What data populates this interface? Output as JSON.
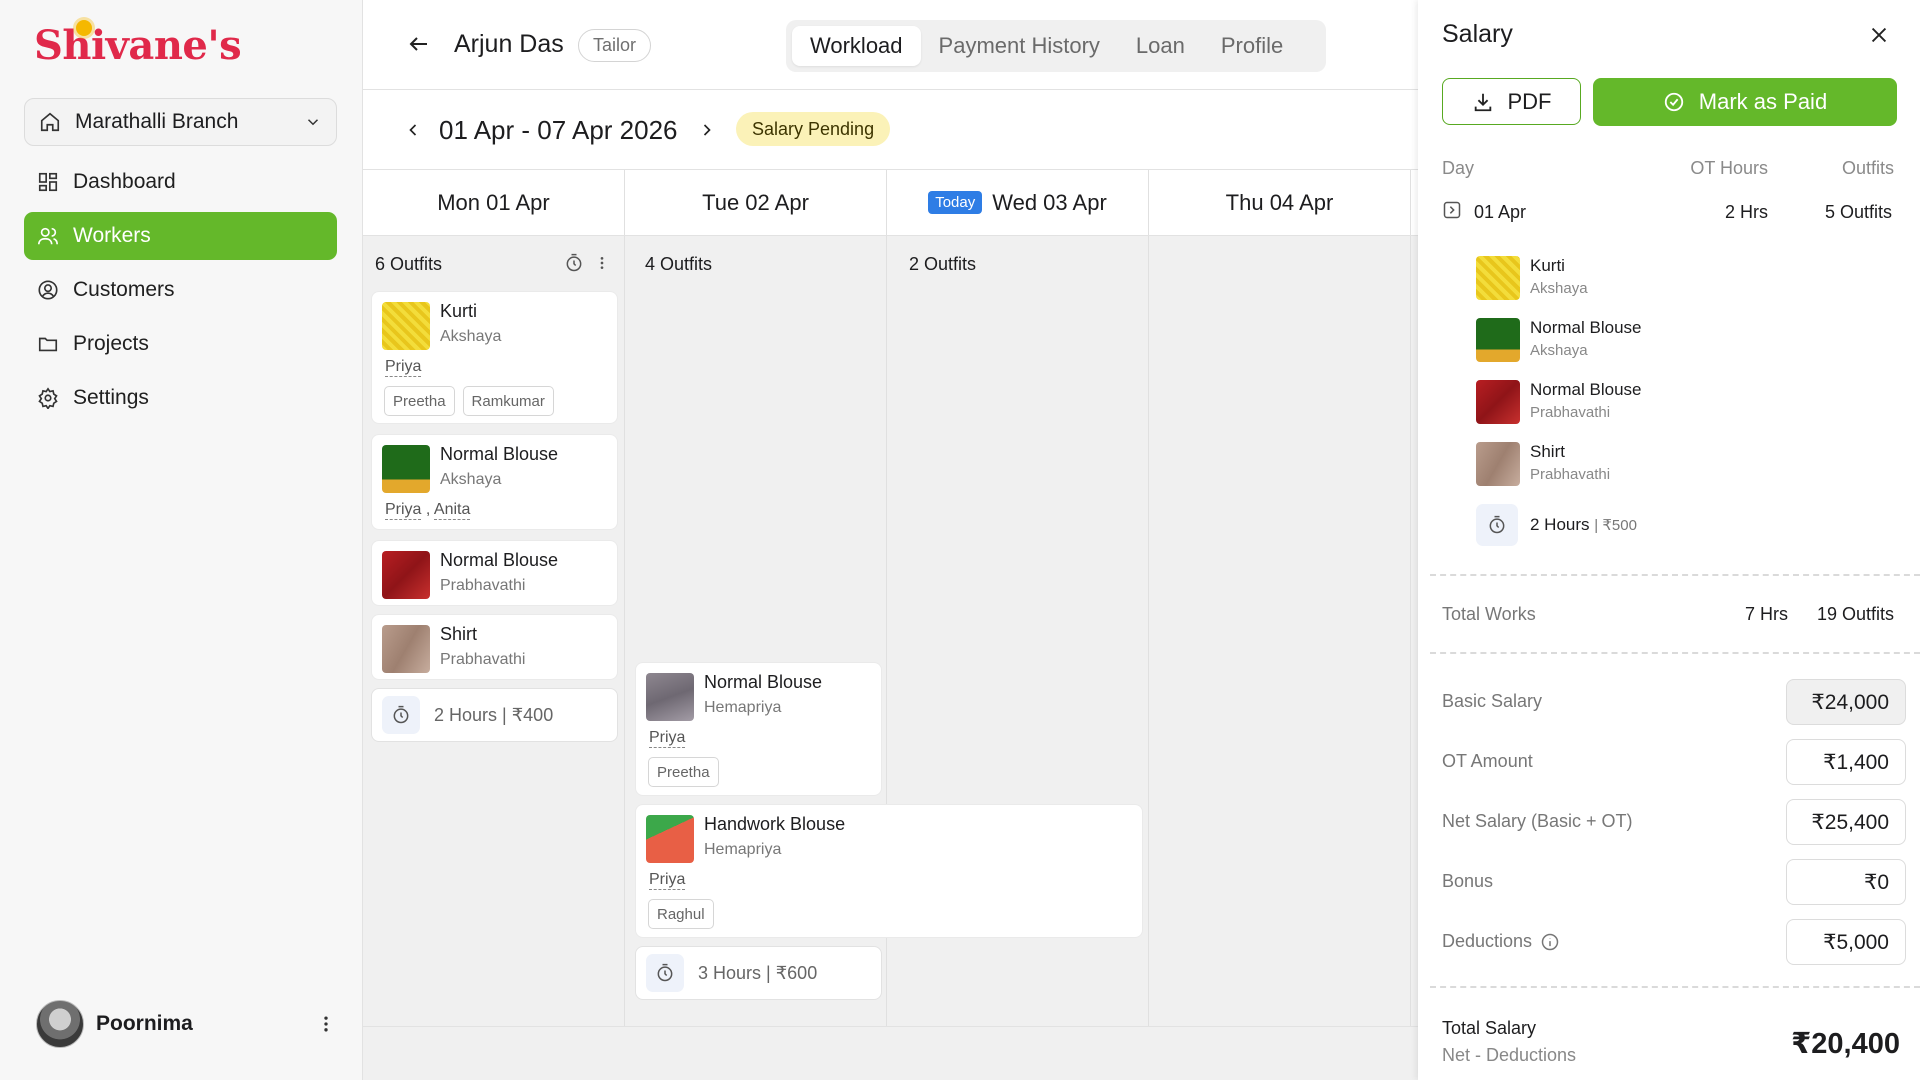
{
  "brand": {
    "name": "Shivane's",
    "colors": {
      "primary": "#64b82a",
      "brand_red": "#e0294a",
      "today": "#2e7de5",
      "pending_bg": "#fbf2b8"
    }
  },
  "sidebar": {
    "branch": "Marathalli Branch",
    "items": [
      {
        "label": "Dashboard",
        "icon": "grid-icon"
      },
      {
        "label": "Workers",
        "icon": "users-icon",
        "active": true
      },
      {
        "label": "Customers",
        "icon": "user-circle-icon"
      },
      {
        "label": "Projects",
        "icon": "folder-icon"
      },
      {
        "label": "Settings",
        "icon": "gear-icon"
      }
    ],
    "user": {
      "name": "Poornima"
    }
  },
  "header": {
    "worker_name": "Arjun Das",
    "role": "Tailor",
    "tabs": [
      "Workload",
      "Payment History",
      "Loan",
      "Profile"
    ],
    "active_tab": "Workload"
  },
  "week": {
    "range": "01 Apr - 07 Apr 2026",
    "status": "Salary Pending"
  },
  "days": [
    {
      "label": "Mon 01 Apr",
      "outfits": "6 Outfits"
    },
    {
      "label": "Tue 02 Apr",
      "outfits": "4 Outfits"
    },
    {
      "label": "Wed 03 Apr",
      "outfits": "2 Outfits",
      "today_label": "Today"
    },
    {
      "label": "Thu 04 Apr",
      "outfits": ""
    }
  ],
  "mon_cards": [
    {
      "title": "Kurti",
      "customer": "Akshaya",
      "assigned": "Priya",
      "chips": [
        "Preetha",
        "Ramkumar"
      ]
    },
    {
      "title": "Normal Blouse",
      "customer": "Akshaya",
      "assigned1": "Priya",
      "assigned2": "Anita"
    },
    {
      "title": "Normal Blouse",
      "customer": "Prabhavathi"
    },
    {
      "title": "Shirt",
      "customer": "Prabhavathi"
    }
  ],
  "mon_hours": {
    "hours": "2 Hours",
    "amount": "₹400"
  },
  "tue_cards": [
    {
      "title": "Normal Blouse",
      "customer": "Hemapriya",
      "assigned": "Priya",
      "chips": [
        "Preetha"
      ]
    },
    {
      "title": "Handwork Blouse",
      "customer": "Hemapriya",
      "assigned": "Priya",
      "chips": [
        "Raghul"
      ]
    }
  ],
  "tue_hours": {
    "hours": "3 Hours",
    "amount": "₹600"
  },
  "salary": {
    "title": "Salary",
    "pdf_label": "PDF",
    "mark_paid_label": "Mark as Paid",
    "columns": {
      "day": "Day",
      "ot": "OT Hours",
      "outfits": "Outfits"
    },
    "row": {
      "day": "01 Apr",
      "ot": "2 Hrs",
      "outfits": "5 Outfits"
    },
    "items": [
      {
        "title": "Kurti",
        "customer": "Akshaya"
      },
      {
        "title": "Normal Blouse",
        "customer": "Akshaya"
      },
      {
        "title": "Normal Blouse",
        "customer": "Prabhavathi"
      },
      {
        "title": "Shirt",
        "customer": "Prabhavathi"
      }
    ],
    "hours": {
      "hours": "2 Hours",
      "amount": "₹500"
    },
    "total_works": {
      "label": "Total Works",
      "hrs": "7 Hrs",
      "outfits": "19 Outfits"
    },
    "basic": {
      "label": "Basic Salary",
      "value": "₹24,000"
    },
    "ot_amount": {
      "label": "OT Amount",
      "value": "₹1,400"
    },
    "net": {
      "label": "Net Salary  (Basic + OT)",
      "value": "₹25,400"
    },
    "bonus": {
      "label": "Bonus",
      "value": "₹0"
    },
    "deductions": {
      "label": "Deductions",
      "value": "₹5,000"
    },
    "total": {
      "label": "Total Salary",
      "sub": "Net - Deductions",
      "value": "₹20,400"
    }
  }
}
